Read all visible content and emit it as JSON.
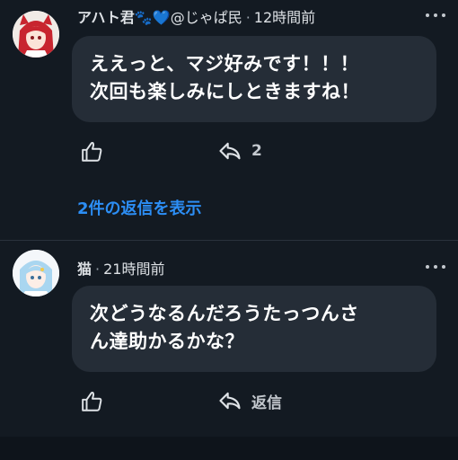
{
  "comments": [
    {
      "author": "アハト君",
      "author_icons": "🐾💙",
      "handle": "@じゃぱ民",
      "time": "12時間前",
      "text_line1": "ええっと、マジ好みです！！！",
      "text_line2": "次回も楽しみにしときますね！",
      "reply_count": "2",
      "view_replies": "2件の返信を表示",
      "avatar_color": "#c8252f"
    },
    {
      "author": "猫",
      "time": "21時間前",
      "text_line1": "次どうなるんだろうたっつんさ",
      "text_line2": "ん達助かるかな？",
      "reply_label": "返信",
      "avatar_color": "#a9d6f0"
    }
  ],
  "separator": "·",
  "colors": {
    "background": "#131a22",
    "bubble": "#252d37",
    "link": "#2c8ef5"
  }
}
